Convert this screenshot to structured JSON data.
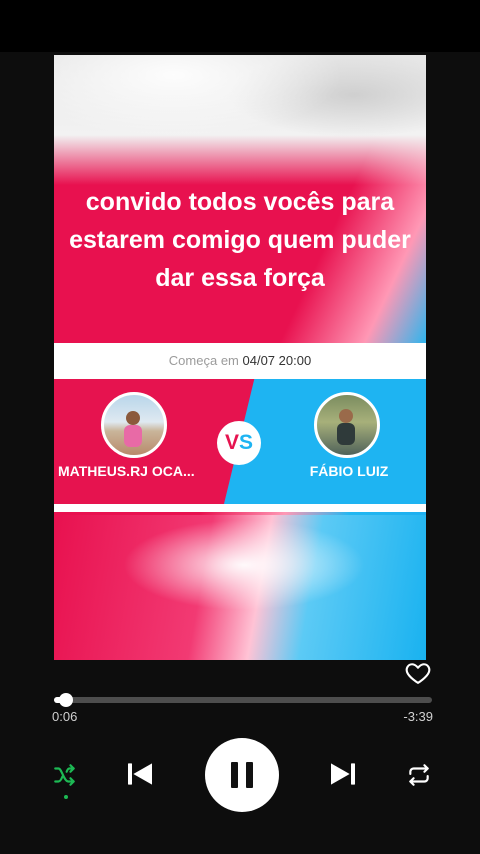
{
  "post": {
    "caption": "convido todos vocês para estarem comigo quem puder dar essa força"
  },
  "battle": {
    "starts_label": "Começa em",
    "starts_datetime": "04/07 20:00",
    "vs_v": "V",
    "vs_s": "S",
    "left_name": "MATHEUS.RJ OCA...",
    "right_name": "FÁBIO LUIZ"
  },
  "player": {
    "elapsed": "0:06",
    "remaining": "-3:39",
    "progress_fraction": 0.033,
    "icons": [
      "heart-icon",
      "shuffle-icon",
      "previous-icon",
      "pause-icon",
      "next-icon",
      "repeat-icon"
    ]
  },
  "colors": {
    "pink": "#e6134f",
    "blue": "#1eb4f2",
    "shuffle_active": "#1db954"
  }
}
